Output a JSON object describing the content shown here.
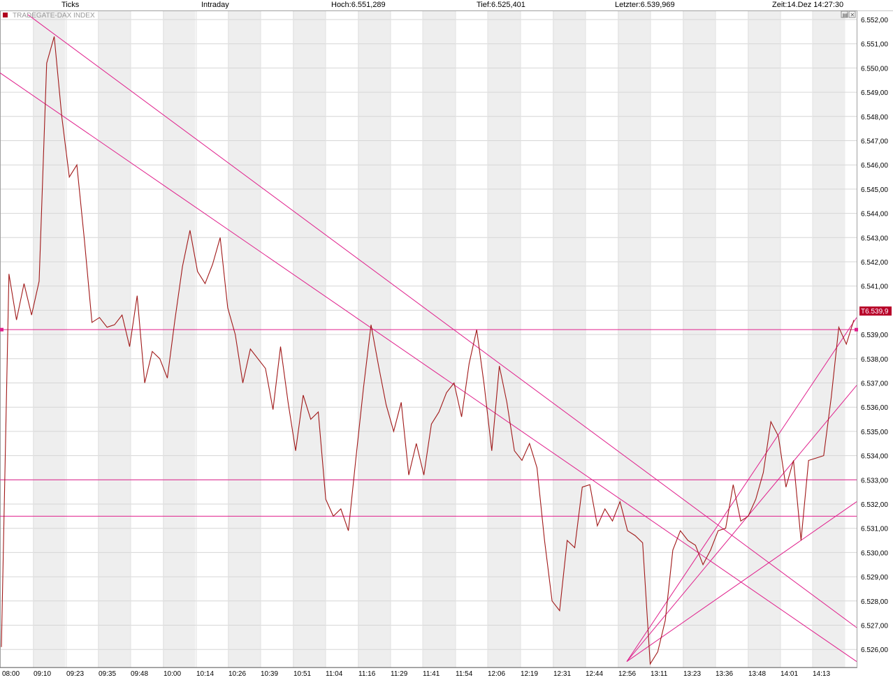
{
  "header": {
    "ticks_label": "Ticks",
    "mode_label": "Intraday",
    "high": "Hoch:6.551,289",
    "low": "Tief:6.525,401",
    "last": "Letzter:6.539,969",
    "time": "Zeit:14.Dez 14:27:30"
  },
  "chart_data": {
    "type": "line",
    "title": "TRADEGATE-DAX INDEX",
    "x": [
      "08:00",
      "09:10",
      "09:23",
      "09:35",
      "09:48",
      "10:00",
      "10:14",
      "10:26",
      "10:39",
      "10:51",
      "11:04",
      "11:16",
      "11:29",
      "11:41",
      "11:54",
      "12:06",
      "12:19",
      "12:31",
      "12:44",
      "12:56",
      "13:11",
      "13:23",
      "13:36",
      "13:48",
      "14:01",
      "14:13"
    ],
    "ylim": [
      6525.4,
      6552.2
    ],
    "yticks": [
      "6.552,00",
      "6.551,00",
      "6.550,00",
      "6.549,00",
      "6.548,00",
      "6.547,00",
      "6.546,00",
      "6.545,00",
      "6.544,00",
      "6.543,00",
      "6.542,00",
      "6.541,00",
      "6.540,00",
      "6.539,00",
      "6.538,00",
      "6.537,00",
      "6.536,00",
      "6.535,00",
      "6.534,00",
      "6.533,00",
      "6.532,00",
      "6.531,00",
      "6.530,00",
      "6.529,00",
      "6.528,00",
      "6.527,00",
      "6.526,00"
    ],
    "series": [
      {
        "values": [
          6526.1,
          6541.5,
          6539.6,
          6541.1,
          6539.8,
          6541.2,
          6550.2,
          6551.3,
          6548.0,
          6545.5,
          6546.0,
          6542.9,
          6539.5,
          6539.7,
          6539.3,
          6539.4,
          6539.8,
          6538.5,
          6540.6,
          6537.0,
          6538.3,
          6538.0,
          6537.2,
          6539.6,
          6541.8,
          6543.3,
          6541.6,
          6541.1,
          6541.9,
          6543.0,
          6540.1,
          6539.0,
          6537.0,
          6538.4,
          6538.0,
          6537.6,
          6535.9,
          6538.5,
          6536.2,
          6534.2,
          6536.5,
          6535.5,
          6535.8,
          6532.2,
          6531.5,
          6531.8,
          6530.9,
          6533.9,
          6536.8,
          6539.4,
          6537.7,
          6536.1,
          6535.0,
          6536.2,
          6533.2,
          6534.5,
          6533.2,
          6535.3,
          6535.8,
          6536.6,
          6537.0,
          6535.6,
          6537.8,
          6539.2,
          6536.9,
          6534.2,
          6537.7,
          6536.2,
          6534.2,
          6533.8,
          6534.5,
          6533.5,
          6530.5,
          6528.0,
          6527.6,
          6530.5,
          6530.2,
          6532.7,
          6532.8,
          6531.1,
          6531.8,
          6531.3,
          6532.1,
          6530.9,
          6530.7,
          6530.4,
          6525.4,
          6525.9,
          6527.2,
          6530.1,
          6530.9,
          6530.5,
          6530.3,
          6529.5,
          6530.1,
          6530.9,
          6531.0,
          6532.8,
          6531.3,
          6531.5,
          6532.2,
          6533.3,
          6535.4,
          6534.8,
          6532.7,
          6533.8,
          6530.5,
          6533.8,
          6533.9,
          6534.0,
          6536.4,
          6539.3,
          6538.6,
          6539.6
        ]
      }
    ],
    "reference_label": "T6.539,9"
  }
}
